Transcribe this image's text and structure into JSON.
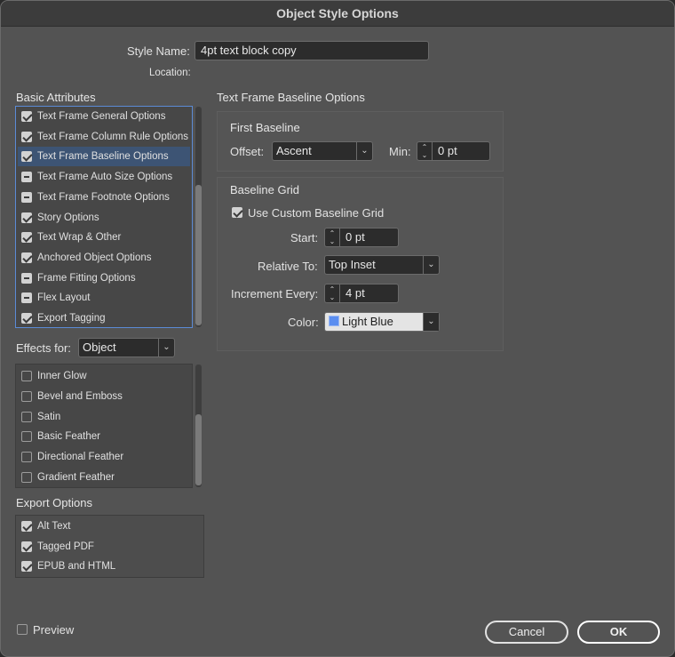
{
  "window": {
    "title": "Object Style Options"
  },
  "style_name": {
    "label": "Style Name:",
    "value": "4pt text block copy"
  },
  "location": {
    "label": "Location:"
  },
  "basic_attributes": {
    "title": "Basic Attributes",
    "items": [
      {
        "label": "Text Frame General Options",
        "state": "checked"
      },
      {
        "label": "Text Frame Column Rule Options",
        "state": "checked"
      },
      {
        "label": "Text Frame Baseline Options",
        "state": "checked"
      },
      {
        "label": "Text Frame Auto Size Options",
        "state": "mixed"
      },
      {
        "label": "Text Frame Footnote Options",
        "state": "mixed"
      },
      {
        "label": "Story Options",
        "state": "checked"
      },
      {
        "label": "Text Wrap & Other",
        "state": "checked"
      },
      {
        "label": "Anchored Object Options",
        "state": "checked"
      },
      {
        "label": "Frame Fitting Options",
        "state": "mixed"
      },
      {
        "label": "Flex Layout",
        "state": "mixed"
      },
      {
        "label": "Export Tagging",
        "state": "checked"
      }
    ]
  },
  "effects": {
    "label": "Effects for:",
    "selected": "Object",
    "items": [
      {
        "label": "Inner Glow",
        "state": "unchecked"
      },
      {
        "label": "Bevel and Emboss",
        "state": "unchecked"
      },
      {
        "label": "Satin",
        "state": "unchecked"
      },
      {
        "label": "Basic Feather",
        "state": "unchecked"
      },
      {
        "label": "Directional Feather",
        "state": "unchecked"
      },
      {
        "label": "Gradient Feather",
        "state": "unchecked"
      }
    ]
  },
  "export_options": {
    "title": "Export Options",
    "items": [
      {
        "label": "Alt Text",
        "state": "checked"
      },
      {
        "label": "Tagged PDF",
        "state": "checked"
      },
      {
        "label": "EPUB and HTML",
        "state": "checked"
      }
    ]
  },
  "baseline_panel": {
    "title": "Text Frame Baseline Options",
    "first_baseline": {
      "title": "First Baseline",
      "offset_label": "Offset:",
      "offset_value": "Ascent",
      "min_label": "Min:",
      "min_value": "0 pt"
    },
    "baseline_grid": {
      "title": "Baseline Grid",
      "use_custom_label": "Use Custom Baseline Grid",
      "use_custom_checked": true,
      "start_label": "Start:",
      "start_value": "0 pt",
      "relative_label": "Relative To:",
      "relative_value": "Top Inset",
      "increment_label": "Increment Every:",
      "increment_value": "4 pt",
      "color_label": "Color:",
      "color_value": "Light Blue",
      "color_hex": "#5b8ef0"
    }
  },
  "footer": {
    "preview_label": "Preview",
    "cancel_label": "Cancel",
    "ok_label": "OK"
  },
  "colors": {
    "dialog_bg": "#535353",
    "selection": "#3d5474",
    "focus": "#5b8bd6"
  }
}
